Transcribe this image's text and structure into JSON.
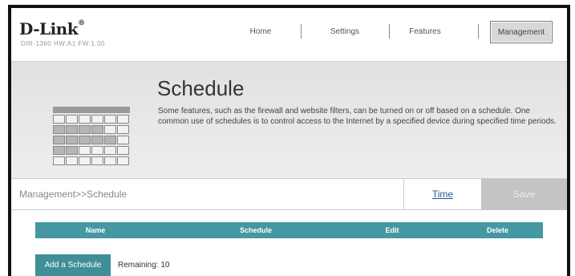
{
  "brand": {
    "logo": "D-Link",
    "reg": "®",
    "model_info": "DIR-1360 HW:A1 FW:1.00"
  },
  "nav": {
    "home": "Home",
    "settings": "Settings",
    "features": "Features",
    "management": "Management"
  },
  "banner": {
    "title": "Schedule",
    "description": "Some features, such as the firewall and website filters, can be turned on or off based on a schedule. One common use of schedules is to control access to the Internet by a specified device during specified time periods."
  },
  "bar": {
    "breadcrumb": "Management>>Schedule",
    "time": "Time",
    "save": "Save"
  },
  "table": {
    "columns": [
      "Name",
      "Schedule",
      "Edit",
      "Delete"
    ]
  },
  "actions": {
    "add": "Add a Schedule",
    "remaining": "Remaining: 10"
  },
  "colors": {
    "accent": "#4597a1",
    "save_disabled": "#c4c4c4",
    "link": "#1f5e96"
  },
  "icons": [
    "calendar-icon"
  ]
}
